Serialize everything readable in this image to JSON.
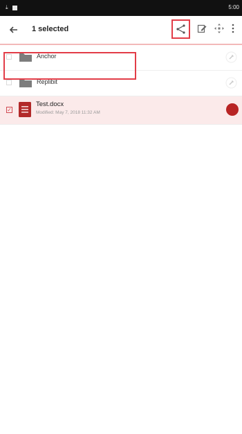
{
  "status_bar": {
    "time": "5:00"
  },
  "toolbar": {
    "title": "1 selected",
    "back_icon": "arrow-left-icon",
    "share_icon": "share-icon",
    "edit_icon": "edit-icon",
    "move_icon": "move-icon",
    "more_icon": "more-vert-icon"
  },
  "files": [
    {
      "name": "Anchor",
      "type": "folder",
      "selected": false
    },
    {
      "name": "Replibit",
      "type": "folder",
      "selected": false
    },
    {
      "name": "Test.docx",
      "type": "document",
      "modified": "Modified: May 7, 2018 11:32 AM",
      "selected": true
    }
  ],
  "colors": {
    "accent": "#e23c47",
    "selected_row": "#fbeaea",
    "doc_icon": "#b22a2a",
    "folder": "#7d7d7d"
  }
}
